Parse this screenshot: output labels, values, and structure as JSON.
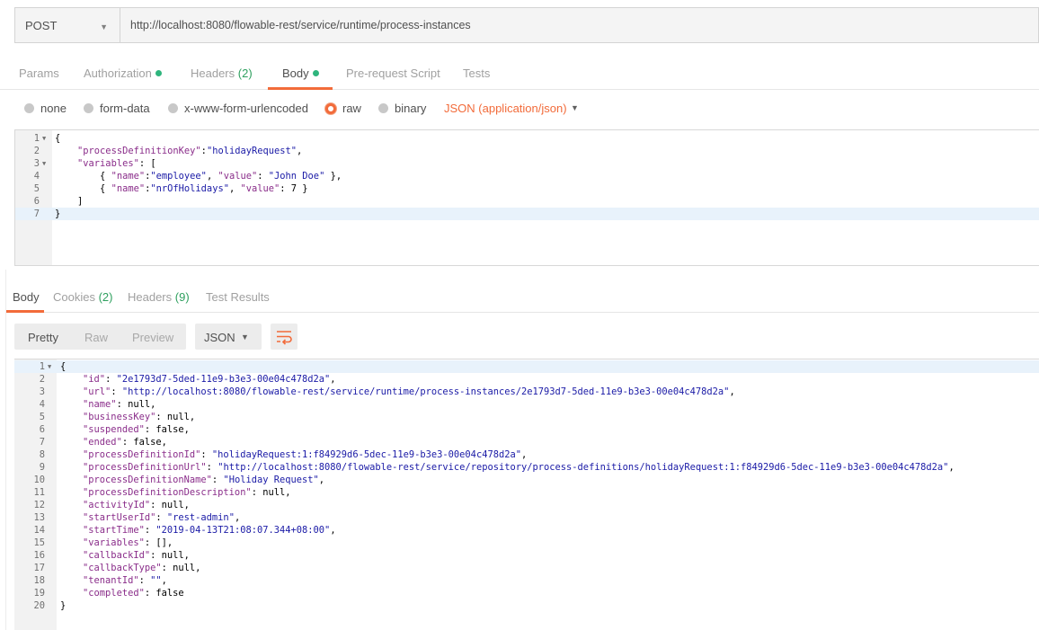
{
  "request": {
    "method": "POST",
    "url": "http://localhost:8080/flowable-rest/service/runtime/process-instances"
  },
  "request_tabs": [
    {
      "label": "Params"
    },
    {
      "label": "Authorization"
    },
    {
      "label": "Headers",
      "count": "(2)"
    },
    {
      "label": "Body"
    },
    {
      "label": "Pre-request Script"
    },
    {
      "label": "Tests"
    }
  ],
  "body_types": [
    "none",
    "form-data",
    "x-www-form-urlencoded",
    "raw",
    "binary"
  ],
  "content_type": "JSON (application/json)",
  "request_body": {
    "line_numbers": [
      "1",
      "2",
      "3",
      "4",
      "5",
      "6",
      "7"
    ],
    "lines": [
      "{",
      "    \"processDefinitionKey\":\"holidayRequest\",",
      "    \"variables\": [",
      "        { \"name\":\"employee\", \"value\": \"John Doe\" },",
      "        { \"name\":\"nrOfHolidays\", \"value\": 7 }",
      "    ]",
      "}"
    ]
  },
  "response_tabs": [
    {
      "label": "Body"
    },
    {
      "label": "Cookies",
      "count": "(2)"
    },
    {
      "label": "Headers",
      "count": "(9)"
    },
    {
      "label": "Test Results"
    }
  ],
  "view_modes": [
    "Pretty",
    "Raw",
    "Preview"
  ],
  "format": "JSON",
  "response_body": {
    "line_numbers": [
      "1",
      "2",
      "3",
      "4",
      "5",
      "6",
      "7",
      "8",
      "9",
      "10",
      "11",
      "12",
      "13",
      "14",
      "15",
      "16",
      "17",
      "18",
      "19",
      "20"
    ],
    "lines": [
      "{",
      "    \"id\": \"2e1793d7-5ded-11e9-b3e3-00e04c478d2a\",",
      "    \"url\": \"http://localhost:8080/flowable-rest/service/runtime/process-instances/2e1793d7-5ded-11e9-b3e3-00e04c478d2a\",",
      "    \"name\": null,",
      "    \"businessKey\": null,",
      "    \"suspended\": false,",
      "    \"ended\": false,",
      "    \"processDefinitionId\": \"holidayRequest:1:f84929d6-5dec-11e9-b3e3-00e04c478d2a\",",
      "    \"processDefinitionUrl\": \"http://localhost:8080/flowable-rest/service/repository/process-definitions/holidayRequest:1:f84929d6-5dec-11e9-b3e3-00e04c478d2a\",",
      "    \"processDefinitionName\": \"Holiday Request\",",
      "    \"processDefinitionDescription\": null,",
      "    \"activityId\": null,",
      "    \"startUserId\": \"rest-admin\",",
      "    \"startTime\": \"2019-04-13T21:08:07.344+08:00\",",
      "    \"variables\": [],",
      "    \"callbackId\": null,",
      "    \"callbackType\": null,",
      "    \"tenantId\": \"\",",
      "    \"completed\": false",
      "}"
    ]
  },
  "colors": {
    "accent": "#f26b3a",
    "status_dot": "#2fb57d",
    "count": "#2fa05f",
    "json_key": "#8a2d8a",
    "json_string": "#1a1aa6"
  },
  "icons": {
    "method_dropdown": "chevron-down-icon",
    "content_type_dropdown": "chevron-down-icon",
    "format_dropdown": "chevron-down-icon",
    "wrap": "wrap-lines-icon"
  }
}
